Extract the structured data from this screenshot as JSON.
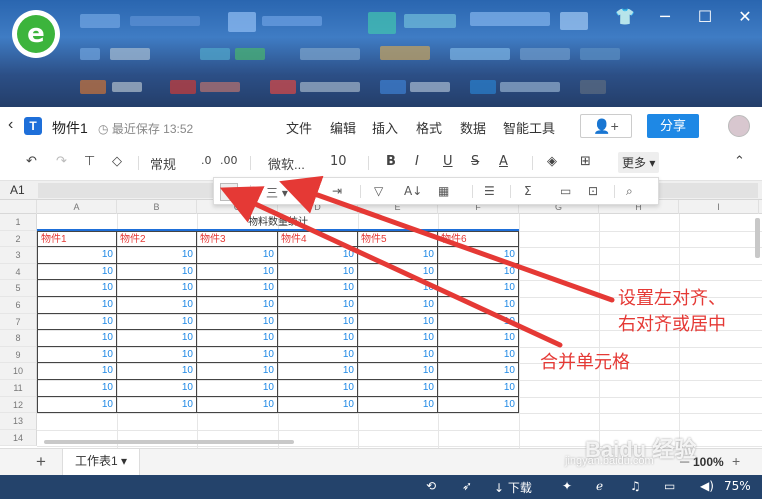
{
  "window": {
    "minimize_glyph": "─",
    "maximize_glyph": "☐",
    "close_glyph": "✕",
    "skin_glyph": "👕",
    "logo_glyph": "e"
  },
  "docbar": {
    "back_glyph": "‹",
    "title": "物件1",
    "save_status": "最近保存 13:52",
    "menus": [
      "文件",
      "编辑",
      "插入",
      "格式",
      "数据",
      "智能工具"
    ],
    "share_user_glyph": "👤+",
    "share_label": "分享"
  },
  "toolbar": {
    "undo": "↶",
    "redo": "↷",
    "format_painter": "⊤",
    "eraser": "◇",
    "number_format": "常规",
    "decimal_dec": ".0",
    "decimal_inc": ".00",
    "font_family": "微软...",
    "font_size": "10",
    "bold": "B",
    "italic": "I",
    "underline": "U",
    "strike": "S",
    "font_color": "A",
    "fill": "◈",
    "borders": "⊞",
    "more": "更多",
    "collapse": "⌃"
  },
  "formulabar": {
    "cell_ref": "A1"
  },
  "popup": {
    "merge": "⊞",
    "align": "三",
    "wrap": "⇥",
    "filter": "▽",
    "sort": "A↓",
    "cond": "▦",
    "freeze": "☰",
    "sum": "Σ",
    "chart": "▭",
    "comment": "⊡",
    "find": "⌕"
  },
  "sheet": {
    "columns": [
      "A",
      "B",
      "C",
      "D",
      "E",
      "F",
      "G",
      "H",
      "I"
    ],
    "rows": [
      "1",
      "2",
      "3",
      "4",
      "5",
      "6",
      "7",
      "8",
      "9",
      "10",
      "11",
      "12",
      "13",
      "14"
    ],
    "merged_title": "物料数量统计",
    "headers": [
      "物件1",
      "物件2",
      "物件3",
      "物件4",
      "物件5",
      "物件6"
    ],
    "values": [
      [
        "10",
        "10",
        "10",
        "10",
        "10",
        "10"
      ],
      [
        "10",
        "10",
        "10",
        "10",
        "10",
        "10"
      ],
      [
        "10",
        "10",
        "10",
        "10",
        "10",
        "10"
      ],
      [
        "10",
        "10",
        "10",
        "10",
        "10",
        "10"
      ],
      [
        "10",
        "10",
        "10",
        "10",
        "10",
        "10"
      ],
      [
        "10",
        "10",
        "10",
        "10",
        "10",
        "10"
      ],
      [
        "10",
        "10",
        "10",
        "10",
        "10",
        "10"
      ],
      [
        "10",
        "10",
        "10",
        "10",
        "10",
        "10"
      ],
      [
        "10",
        "10",
        "10",
        "10",
        "10",
        "10"
      ],
      [
        "10",
        "10",
        "10",
        "10",
        "10",
        "10"
      ]
    ]
  },
  "tabs": {
    "add": "+",
    "sheet1": "工作表1 ▾",
    "zoom": "100%",
    "zoom_minus": "─",
    "zoom_plus": "+"
  },
  "taskbar": {
    "download": "↓ 下载",
    "battery": "75%"
  },
  "annotations": {
    "align_note_line1": "设置左对齐、",
    "align_note_line2": "右对齐或居中",
    "merge_note": "合并单元格"
  },
  "watermark": {
    "brand": "Baidu 经验",
    "url": "jingyan.baidu.com"
  }
}
